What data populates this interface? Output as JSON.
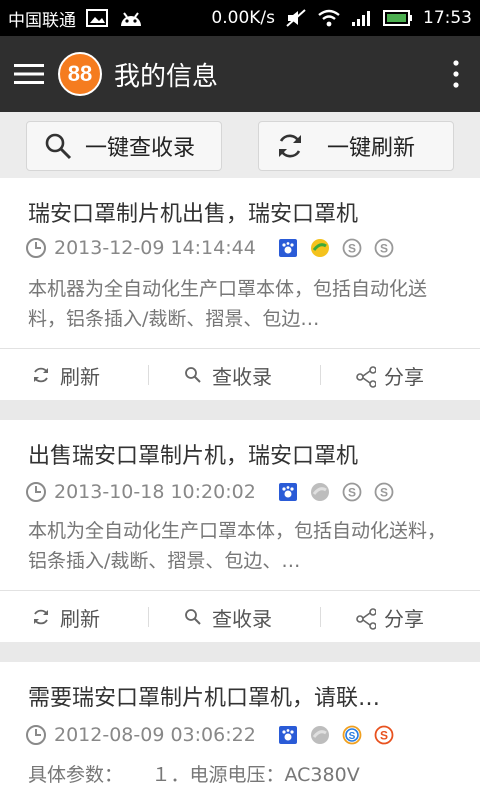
{
  "status_bar": {
    "carrier": "中国联通",
    "net_speed": "0.00K/s",
    "time": "17:53"
  },
  "app_bar": {
    "logo_text": "88",
    "title": "我的信息"
  },
  "toolbar": {
    "search_label": "一键查收录",
    "refresh_label": "一键刷新"
  },
  "actions": {
    "refresh": "刷新",
    "check": "查收录",
    "share": "分享"
  },
  "posts": [
    {
      "title": "瑞安口罩制片机出售，瑞安口罩机",
      "date": "2013-12-09 14:14:44",
      "desc": "本机器为全自动化生产口罩本体，包括自动化送料，铝条插入/裁断、摺景、包边…"
    },
    {
      "title": "出售瑞安口罩制片机，瑞安口罩机",
      "date": "2013-10-18 10:20:02",
      "desc": "本机为全自动化生产口罩本体，包括自动化送料，铝条插入/裁断、摺景、包边、…"
    },
    {
      "title": "需要瑞安口罩制片机口罩机，请联…",
      "date": "2012-08-09 03:06:22",
      "desc": "具体参数：　　１．电源电压：AC380V"
    }
  ],
  "colors": {
    "app_bar": "#2f2f2f",
    "logo": "#f57c1f",
    "battery": "#4caf50"
  }
}
